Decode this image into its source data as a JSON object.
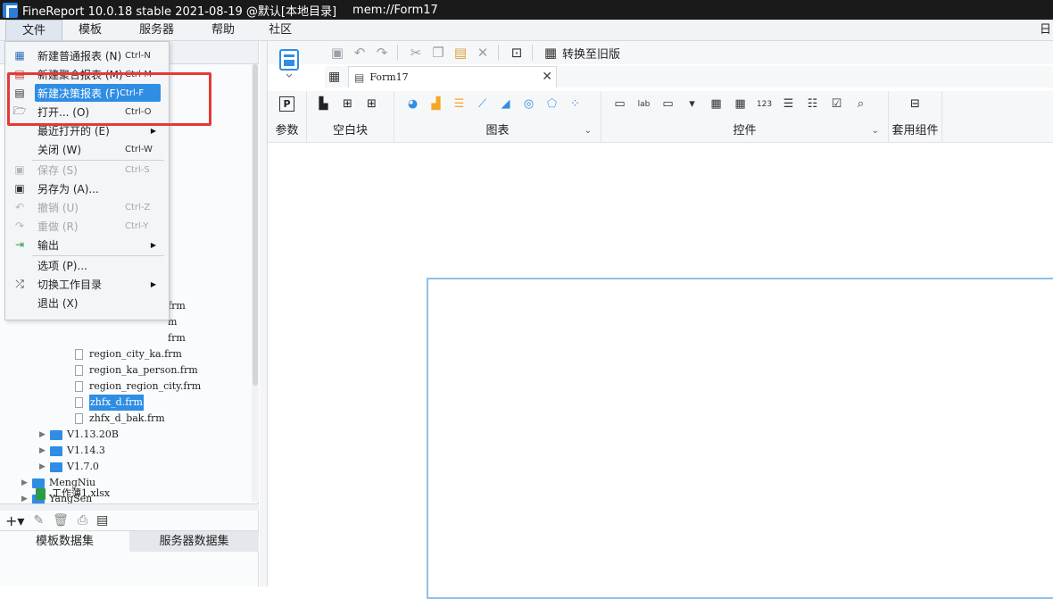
{
  "titlebar": {
    "title": "FineReport 10.0.18 stable 2021-08-19 @默认[本地目录]",
    "mem": "mem://Form17"
  },
  "menubar": {
    "items": [
      "文件",
      "模板",
      "服务器",
      "帮助",
      "社区"
    ],
    "right_fragment": "日"
  },
  "file_menu": {
    "items": [
      {
        "label": "新建普通报表 (N)",
        "shortcut": "Ctrl-N",
        "icon": "grid-report-icon"
      },
      {
        "label": "新建聚合报表 (M)",
        "shortcut": "Ctrl-M",
        "icon": "aggregate-report-icon"
      },
      {
        "label": "新建决策报表 (F)",
        "shortcut": "Ctrl-F",
        "icon": "dashboard-report-icon"
      },
      {
        "label": "打开... (O)",
        "shortcut": "Ctrl-O",
        "icon": "open-folder-icon"
      },
      {
        "label": "最近打开的 (E)",
        "shortcut": "",
        "icon": ""
      },
      {
        "label": "关闭 (W)",
        "shortcut": "Ctrl-W",
        "icon": ""
      },
      {
        "label": "保存 (S)",
        "shortcut": "Ctrl-S",
        "icon": "save-icon"
      },
      {
        "label": "另存为 (A)...",
        "shortcut": "",
        "icon": "save-as-icon"
      },
      {
        "label": "撤销 (U)",
        "shortcut": "Ctrl-Z",
        "icon": "undo-icon"
      },
      {
        "label": "重做 (R)",
        "shortcut": "Ctrl-Y",
        "icon": "redo-icon"
      },
      {
        "label": "输出",
        "shortcut": "",
        "icon": "export-icon"
      },
      {
        "label": "选项 (P)...",
        "shortcut": "",
        "icon": ""
      },
      {
        "label": "切换工作目录",
        "shortcut": "",
        "icon": "switch-directory-icon"
      },
      {
        "label": "退出 (X)",
        "shortcut": "",
        "icon": ""
      }
    ]
  },
  "file_tree": {
    "partial_rows": [
      "frm",
      "m",
      "frm"
    ],
    "files": [
      "region_city_ka.frm",
      "region_ka_person.frm",
      "region_region_city.frm",
      "zhfx_d.frm",
      "zhfx_d_bak.frm"
    ],
    "folders": [
      "V1.13.20B",
      "V1.14.3",
      "V1.7.0"
    ],
    "top_folders": [
      "MengNiu",
      "YangSen"
    ],
    "xlsx": "工作薄1.xlsx",
    "selected": "zhfx_d.frm"
  },
  "left_tabs": [
    "模板数据集",
    "服务器数据集"
  ],
  "toolbar": {
    "convert_label": "转换至旧版"
  },
  "doc_tab": {
    "title": "Form17"
  },
  "widget_groups": {
    "param": "参数",
    "blank": "空白块",
    "chart": "图表",
    "controls": "控件",
    "component": "套用组件"
  }
}
